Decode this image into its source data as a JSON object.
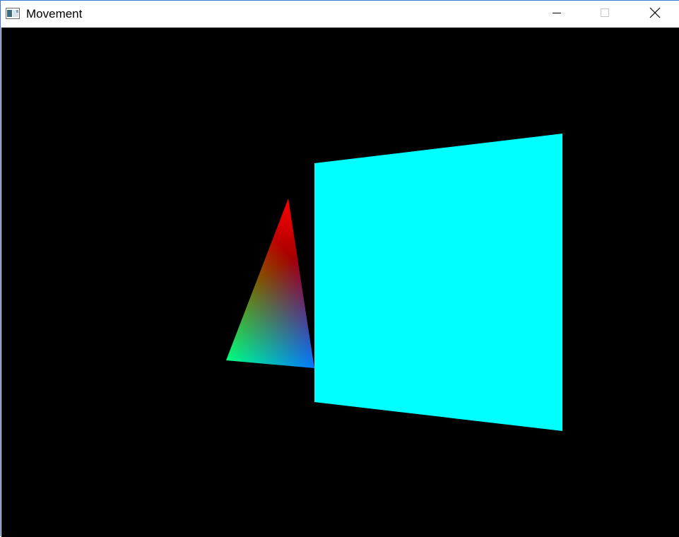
{
  "window": {
    "title": "Movement",
    "icon": "app-window-icon",
    "caption_buttons": [
      "minimize-icon",
      "maximize-icon",
      "close-icon"
    ]
  },
  "scene": {
    "background_color": "#000000",
    "triangle_vertex_colors": [
      "#ff0000",
      "#00ff00",
      "#0000ff"
    ],
    "quad_color": "#00ffff"
  }
}
